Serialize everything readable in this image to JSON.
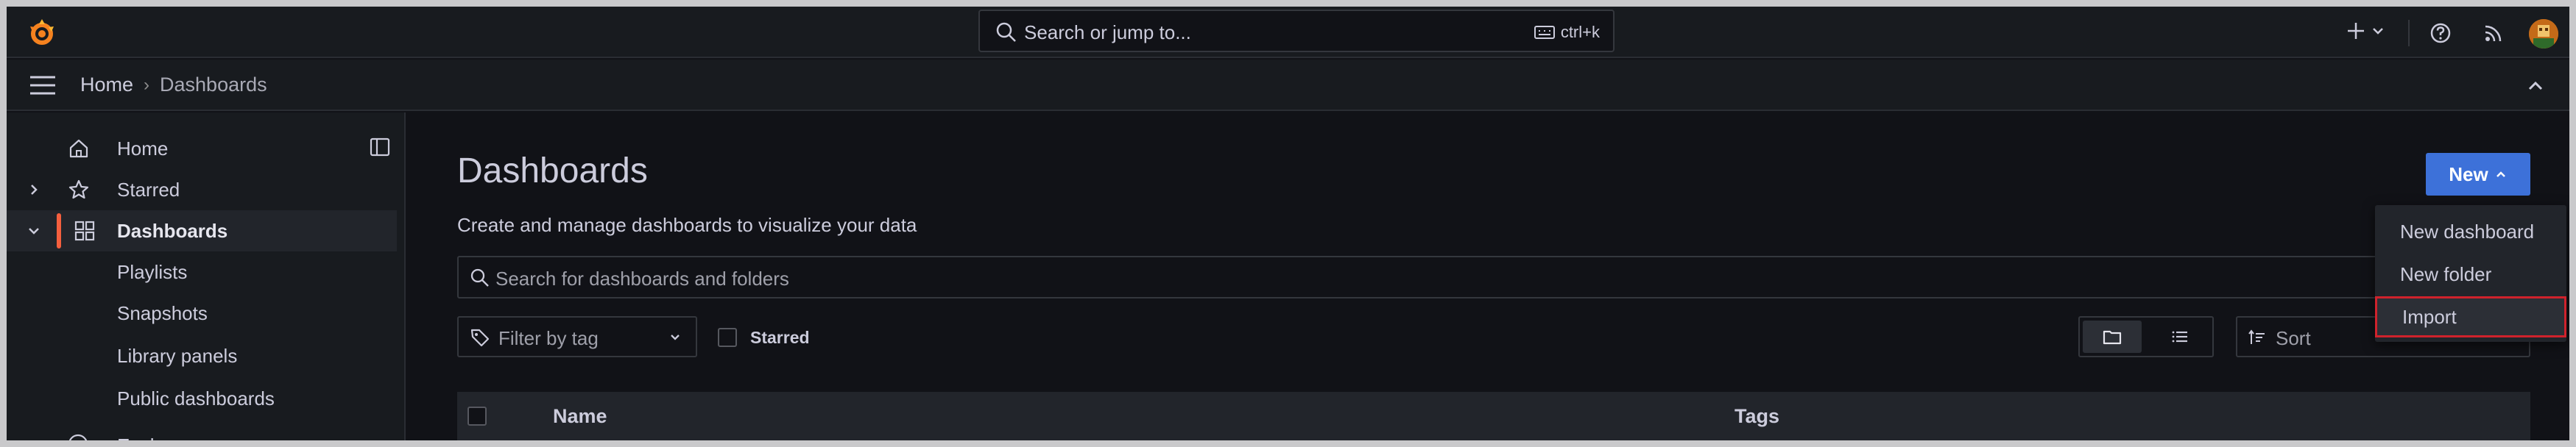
{
  "topbar": {
    "search_placeholder": "Search or jump to...",
    "shortcut": "ctrl+k"
  },
  "breadcrumb": {
    "home": "Home",
    "separator": "›",
    "current": "Dashboards"
  },
  "sidebar": {
    "items": [
      {
        "label": "Home",
        "icon": "home-icon"
      },
      {
        "label": "Starred",
        "icon": "star-icon"
      },
      {
        "label": "Dashboards",
        "icon": "grid-icon",
        "active": true
      },
      {
        "label": "Playlists"
      },
      {
        "label": "Snapshots"
      },
      {
        "label": "Library panels"
      },
      {
        "label": "Public dashboards"
      }
    ],
    "peek_label": "Explore"
  },
  "main": {
    "title": "Dashboards",
    "subtitle": "Create and manage dashboards to visualize your data",
    "new_button": "New",
    "search_placeholder": "Search for dashboards and folders",
    "tag_filter": "Filter by tag",
    "starred_label": "Starred",
    "sort_label": "Sort",
    "table_headers": [
      "Name",
      "Tags"
    ]
  },
  "new_menu": {
    "items": [
      "New dashboard",
      "New folder",
      "Import"
    ],
    "highlighted": "Import"
  },
  "colors": {
    "background": "#111217",
    "panel": "#181b1f",
    "accent": "#3d71d9",
    "active_bar": "#f55f3e",
    "highlight_border": "#d0222c"
  }
}
